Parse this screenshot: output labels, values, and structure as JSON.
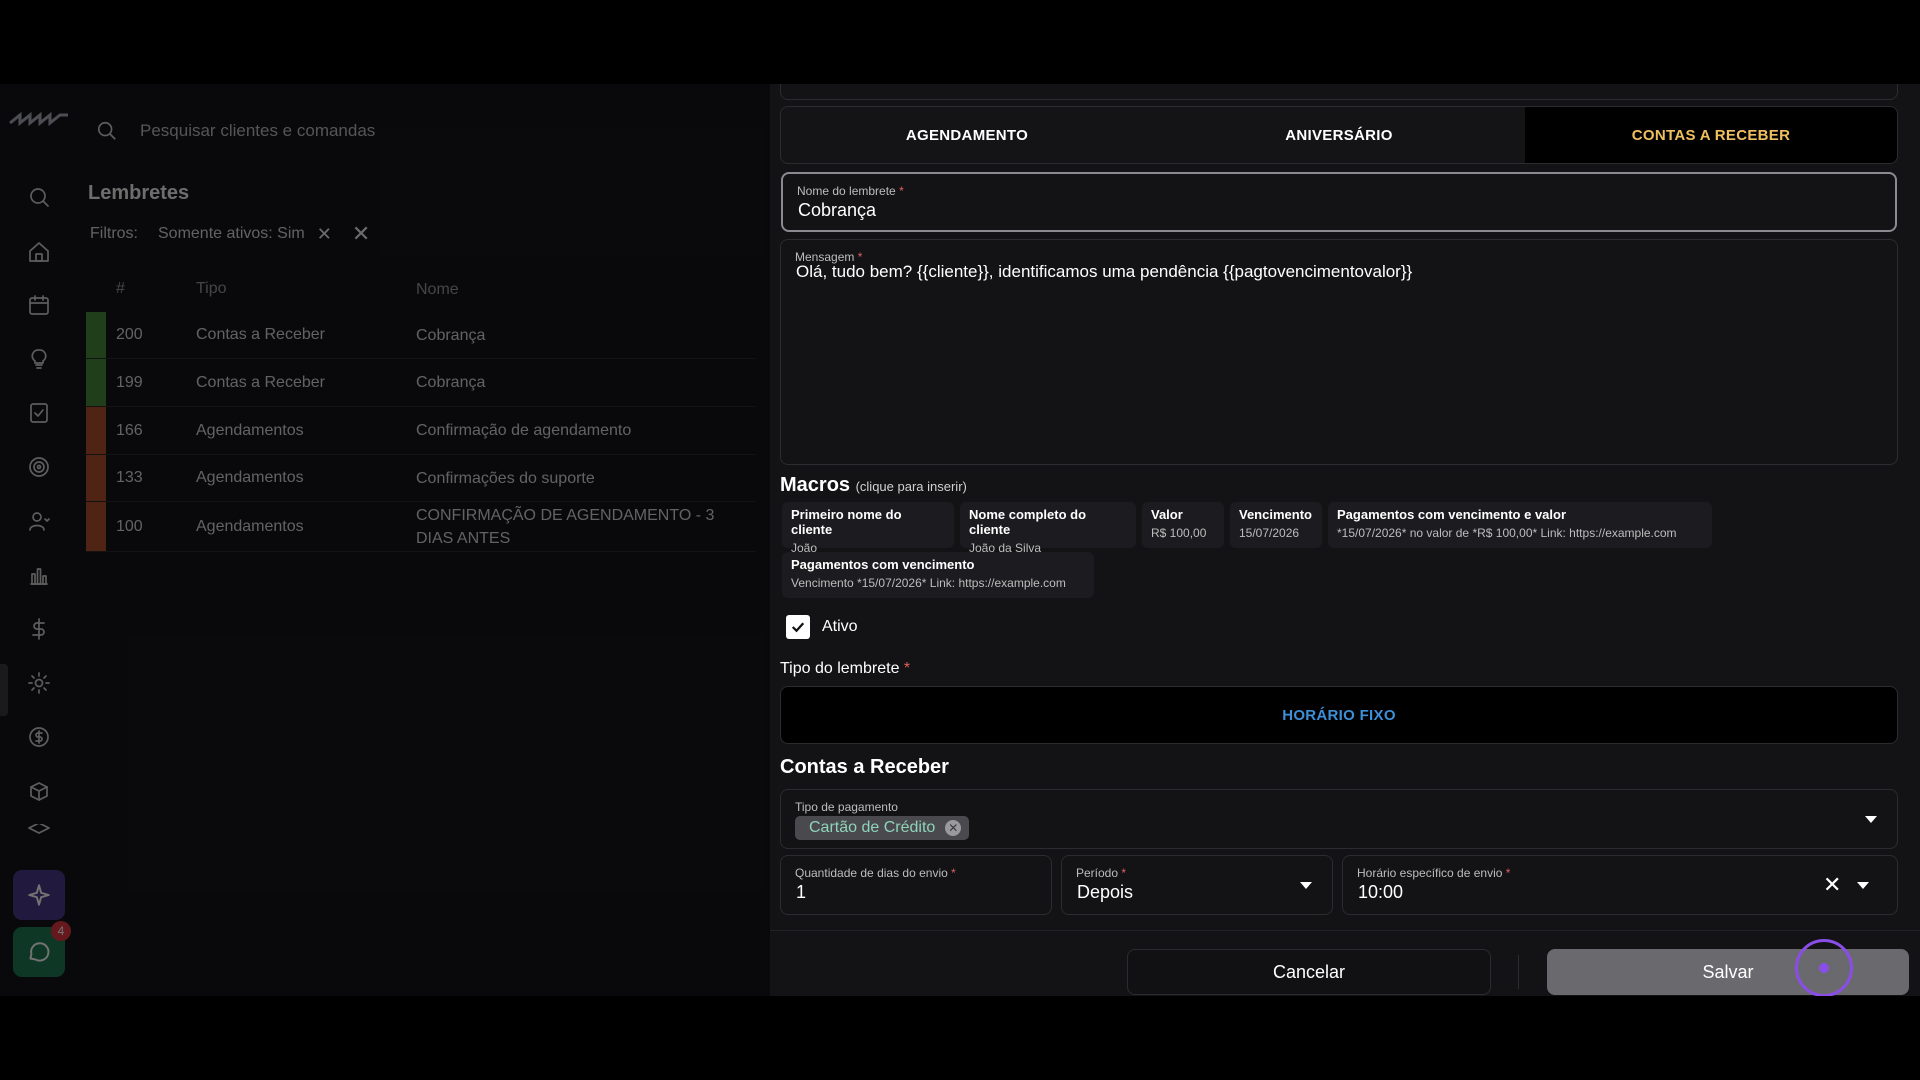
{
  "search": {
    "placeholder": "Pesquisar clientes e comandas"
  },
  "page": {
    "title": "Lembretes"
  },
  "filters": {
    "label": "Filtros:",
    "chip": "Somente ativos: Sim"
  },
  "table": {
    "headers": [
      "#",
      "Tipo",
      "Nome"
    ],
    "rows": [
      {
        "id": "200",
        "tipo": "Contas a Receber",
        "nome": "Cobrança",
        "color": "#4a8a3a"
      },
      {
        "id": "199",
        "tipo": "Contas a Receber",
        "nome": "Cobrança",
        "color": "#4a8a3a"
      },
      {
        "id": "166",
        "tipo": "Agendamentos",
        "nome": "Confirmação de agendamento",
        "color": "#b0502e"
      },
      {
        "id": "133",
        "tipo": "Agendamentos",
        "nome": "Confirmações do suporte",
        "color": "#b0502e"
      },
      {
        "id": "100",
        "tipo": "Agendamentos",
        "nome": "CONFIRMAÇÃO DE AGENDAMENTO - 3 DIAS ANTES",
        "color": "#b0502e"
      }
    ]
  },
  "rail": {
    "badge": "4"
  },
  "tabs": [
    {
      "label": "AGENDAMENTO"
    },
    {
      "label": "ANIVERSÁRIO"
    },
    {
      "label": "CONTAS A RECEBER"
    }
  ],
  "form": {
    "nome_label": "Nome do lembrete",
    "nome_value": "Cobrança",
    "mensagem_label": "Mensagem",
    "mensagem_value": "Olá, tudo bem? {{cliente}}, identificamos uma pendência {{pagtovencimentovalor}}",
    "required_mark": "*"
  },
  "macros": {
    "title": "Macros",
    "hint": "(clique para inserir)",
    "items": [
      {
        "title": "Primeiro nome do cliente",
        "value": "João"
      },
      {
        "title": "Nome completo do cliente",
        "value": "João da Silva"
      },
      {
        "title": "Valor",
        "value": "R$ 100,00"
      },
      {
        "title": "Vencimento",
        "value": "15/07/2026"
      },
      {
        "title": "Pagamentos com vencimento e valor",
        "value": "*15/07/2026* no valor de *R$ 100,00* Link: https://example.com"
      },
      {
        "title": "Pagamentos com vencimento",
        "value": "Vencimento *15/07/2026* Link: https://example.com"
      }
    ]
  },
  "ativo": {
    "label": "Ativo",
    "checked": true
  },
  "tipo": {
    "label": "Tipo do lembrete",
    "option": "HORÁRIO FIXO"
  },
  "contas": {
    "title": "Contas a Receber",
    "tipo_pagamento_label": "Tipo de pagamento",
    "tipo_pagamento_tag": "Cartão de Crédito",
    "dias_label": "Quantidade de dias do envio",
    "dias_value": "1",
    "periodo_label": "Período",
    "periodo_value": "Depois",
    "horario_label": "Horário específico de envio",
    "horario_value": "10:00"
  },
  "footer": {
    "cancel": "Cancelar",
    "save": "Salvar"
  }
}
